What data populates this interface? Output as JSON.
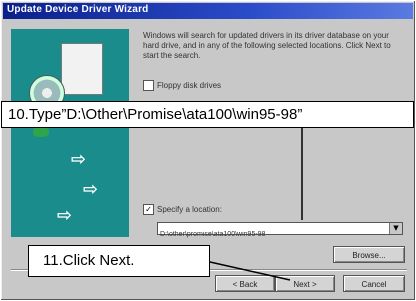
{
  "window": {
    "title": "Update Device Driver Wizard"
  },
  "intro_text": "Windows will search for updated drivers in its driver database on your hard drive, and in any of the following selected locations. Click Next to start the search.",
  "options": [
    {
      "label": "Floppy disk drives",
      "checked": false
    },
    {
      "label": "Specify a location:",
      "checked": true
    }
  ],
  "location_field": {
    "value": "D:\\other\\promise\\ata100\\win95-98"
  },
  "buttons": {
    "browse": "Browse...",
    "back": "< Back",
    "next": "Next >",
    "cancel": "Cancel"
  },
  "callouts": {
    "step10": "10.Type”D:\\Other\\Promise\\ata100\\win95-98”",
    "step11": "11.Click Next."
  },
  "colors": {
    "titlebar": "#0a1f8a",
    "art_bg": "#1a8c8c",
    "dialog_bg": "#c8c8c8"
  }
}
